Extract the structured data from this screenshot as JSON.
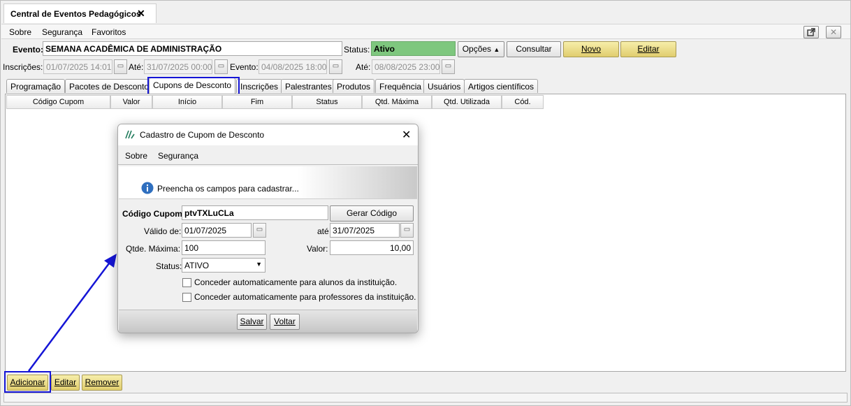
{
  "window": {
    "tab_title": "Central de Eventos Pedagógicos",
    "tab_close": "✕"
  },
  "menu": {
    "items": [
      "Sobre",
      "Segurança",
      "Favoritos"
    ],
    "sobre_rest": "obre",
    "sobre_first": "S"
  },
  "event": {
    "label": "Evento:",
    "name": "SEMANA ACADÊMICA DE ADMINISTRAÇÃO",
    "status_label": "Status:",
    "status_value": "Ativo",
    "status_color": "#7ec77e",
    "inscricoes_label": "Inscrições:",
    "inscricoes_start": "01/07/2025 14:01",
    "ate_label": "Até:",
    "inscricoes_end": "31/07/2025 00:00",
    "evento_label": "Evento:",
    "evento_start": "04/08/2025 18:00",
    "ate2_label": "Até:",
    "evento_end": "08/08/2025 23:00"
  },
  "actions": {
    "opcoes": "Opções",
    "consultar": "Consultar",
    "novo": "Novo",
    "editar": "Editar"
  },
  "tabs": [
    "Programação",
    "Pacotes de Desconto",
    "Cupons de Desconto",
    "Inscrições",
    "Palestrantes",
    "Produtos",
    "Frequência",
    "Usuários",
    "Artigos científicos"
  ],
  "active_tab": "Cupons de Desconto",
  "table": {
    "columns": [
      "Código Cupom",
      "Valor",
      "Início",
      "Fim",
      "Status",
      "Qtd. Máxima",
      "Qtd. Utilizada",
      "Cód."
    ]
  },
  "bottom_buttons": {
    "adicionar": "Adicionar",
    "editar": "Editar",
    "remover": "Remover"
  },
  "dialog": {
    "title": "Cadastro de Cupom de Desconto",
    "menu": [
      "Sobre",
      "Segurança"
    ],
    "info": "Preencha os campos para cadastrar...",
    "codigo_label": "Código Cupom:",
    "codigo_value": "ptvTXLuCLa",
    "gerar_codigo": "Gerar Código",
    "valido_label": "Válido de:",
    "valido_de": "01/07/2025",
    "ate_label": "até",
    "valido_ate": "31/07/2025",
    "qtde_label": "Qtde. Máxima:",
    "qtde_value": "100",
    "valor_label": "Valor:",
    "valor_value": "10,00",
    "status_label": "Status:",
    "status_value": "ATIVO",
    "check_alunos": "Conceder automaticamente para alunos da instituição.",
    "check_professores": "Conceder automaticamente para professores da instituição.",
    "salvar": "Salvar",
    "voltar": "Voltar"
  },
  "colors": {
    "highlight": "#1515d6",
    "gold_button": "#ecdb86",
    "info_icon": "#2f6fbf"
  }
}
